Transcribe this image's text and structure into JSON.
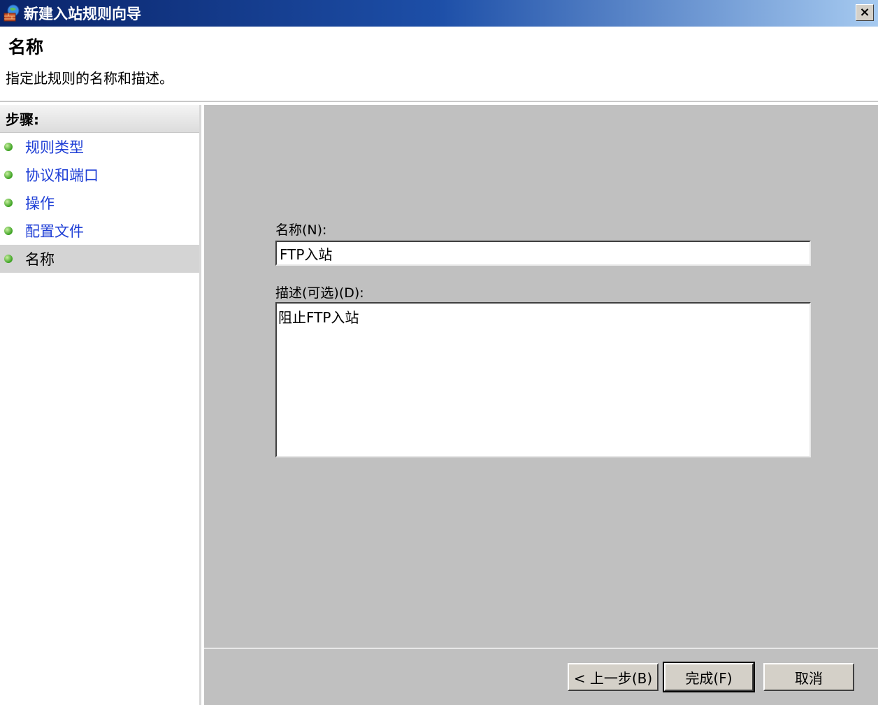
{
  "window": {
    "title": "新建入站规则向导",
    "close_label": "×"
  },
  "header": {
    "title": "名称",
    "subtitle": "指定此规则的名称和描述。"
  },
  "sidebar": {
    "header": "步骤:",
    "items": [
      {
        "label": "规则类型"
      },
      {
        "label": "协议和端口"
      },
      {
        "label": "操作"
      },
      {
        "label": "配置文件"
      },
      {
        "label": "名称"
      }
    ]
  },
  "form": {
    "name_label": "名称(N):",
    "name_value": "FTP入站",
    "description_label": "描述(可选)(D):",
    "description_value": "阻止FTP入站"
  },
  "buttons": {
    "back": "< 上一步(B)",
    "finish": "完成(F)",
    "cancel": "取消"
  }
}
